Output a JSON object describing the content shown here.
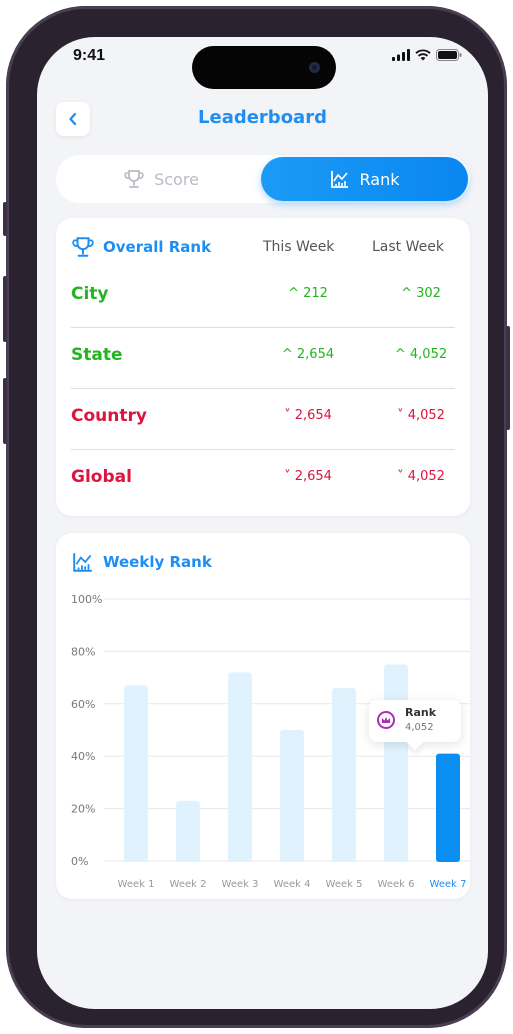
{
  "status": {
    "time": "9:41"
  },
  "header": {
    "title": "Leaderboard",
    "back_icon": "chevron-left-icon"
  },
  "tabs": [
    {
      "label": "Score",
      "icon": "trophy-icon",
      "selected": false
    },
    {
      "label": "Rank",
      "icon": "chart-icon",
      "selected": true
    }
  ],
  "overall": {
    "title": "Overall Rank",
    "col_this_week": "This Week",
    "col_last_week": "Last Week",
    "rows": [
      {
        "name": "City",
        "this_week": "212",
        "last_week": "302",
        "trend": "up"
      },
      {
        "name": "State",
        "this_week": "2,654",
        "last_week": "4,052",
        "trend": "up"
      },
      {
        "name": "Country",
        "this_week": "2,654",
        "last_week": "4,052",
        "trend": "down"
      },
      {
        "name": "Global",
        "this_week": "2,654",
        "last_week": "4,052",
        "trend": "down"
      }
    ]
  },
  "weekly": {
    "title": "Weekly Rank",
    "tooltip_title": "Rank",
    "tooltip_value": "4,052"
  },
  "colors": {
    "accent": "#1f8ef2",
    "up": "#22b520",
    "down": "#dc1440",
    "bar_light": "#dff2fd",
    "bar_active": "#0a8ef2"
  },
  "chart_data": {
    "type": "bar",
    "categories": [
      "Week 1",
      "Week 2",
      "Week 3",
      "Week 4",
      "Week 5",
      "Week 6",
      "Week 7"
    ],
    "values": [
      67,
      23,
      72,
      50,
      66,
      75,
      41
    ],
    "highlighted": "Week 7",
    "y_ticks": [
      "0%",
      "20%",
      "40%",
      "60%",
      "80%",
      "100%"
    ],
    "ylim": [
      0,
      100
    ],
    "grid": true
  }
}
